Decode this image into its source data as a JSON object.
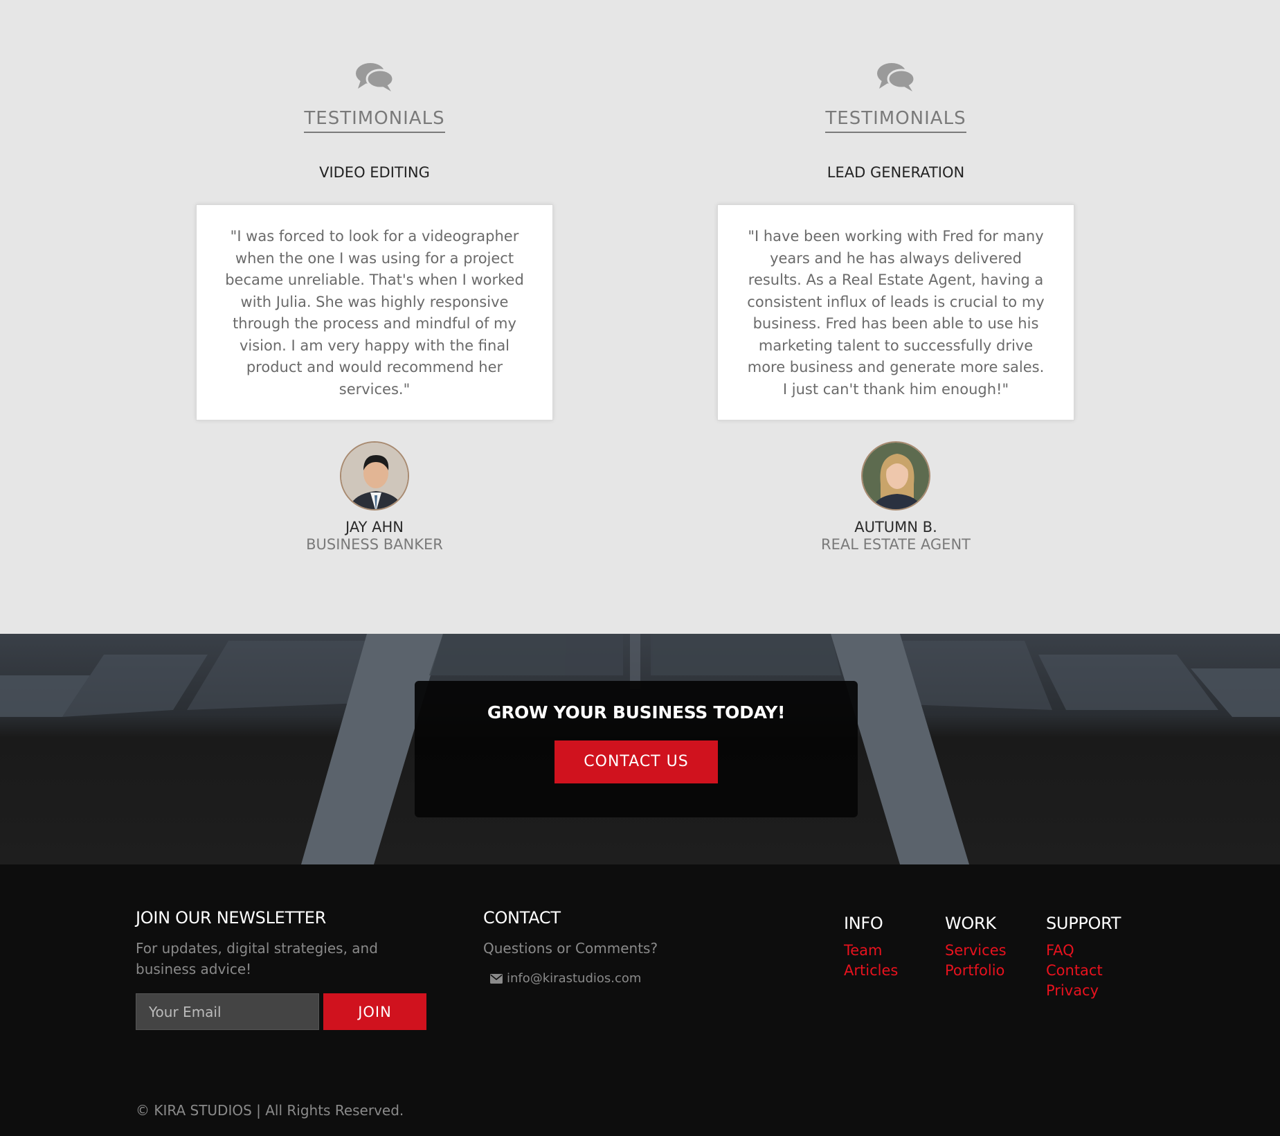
{
  "testimonials": [
    {
      "heading": "TESTIMONIALS",
      "category": "VIDEO EDITING",
      "quote": "\"I was forced to look for a videographer when the one I was using for a project became unreliable. That's when I worked with Julia. She was highly responsive through the process and mindful of my vision. I am very happy with the final product and would recommend her services.\"",
      "name": "JAY AHN",
      "role": "BUSINESS BANKER"
    },
    {
      "heading": "TESTIMONIALS",
      "category": "LEAD GENERATION",
      "quote": "\"I have been working with Fred for many years and he has always delivered results. As a Real Estate Agent, having a consistent influx of leads is crucial to my business. Fred has been able to use his marketing talent to successfully drive more business and generate more sales. I just can't thank him enough!\"",
      "name": "AUTUMN B.",
      "role": "REAL ESTATE AGENT"
    }
  ],
  "cta": {
    "title": "GROW YOUR BUSINESS TODAY!",
    "button": "CONTACT US"
  },
  "footer": {
    "newsletter": {
      "title": "JOIN OUR NEWSLETTER",
      "text": "For updates, digital strategies, and business advice!",
      "placeholder": "Your Email",
      "button": "JOIN"
    },
    "contact": {
      "title": "CONTACT",
      "text": "Questions or Comments?",
      "email": "info@kirastudios.com"
    },
    "info": {
      "title": "INFO",
      "links": [
        "Team",
        "Articles"
      ]
    },
    "work": {
      "title": "WORK",
      "links": [
        "Services",
        "Portfolio"
      ]
    },
    "support": {
      "title": "SUPPORT",
      "links": [
        "FAQ",
        "Contact",
        "Privacy"
      ]
    },
    "copyright": "© KIRA STUDIOS | All Rights Reserved."
  },
  "colors": {
    "accent": "#d0121e",
    "link": "#e8121e",
    "footer_bg": "#0d0d0d",
    "section_bg": "#e6e6e6"
  },
  "icons": [
    "comments-icon",
    "envelope-icon"
  ]
}
